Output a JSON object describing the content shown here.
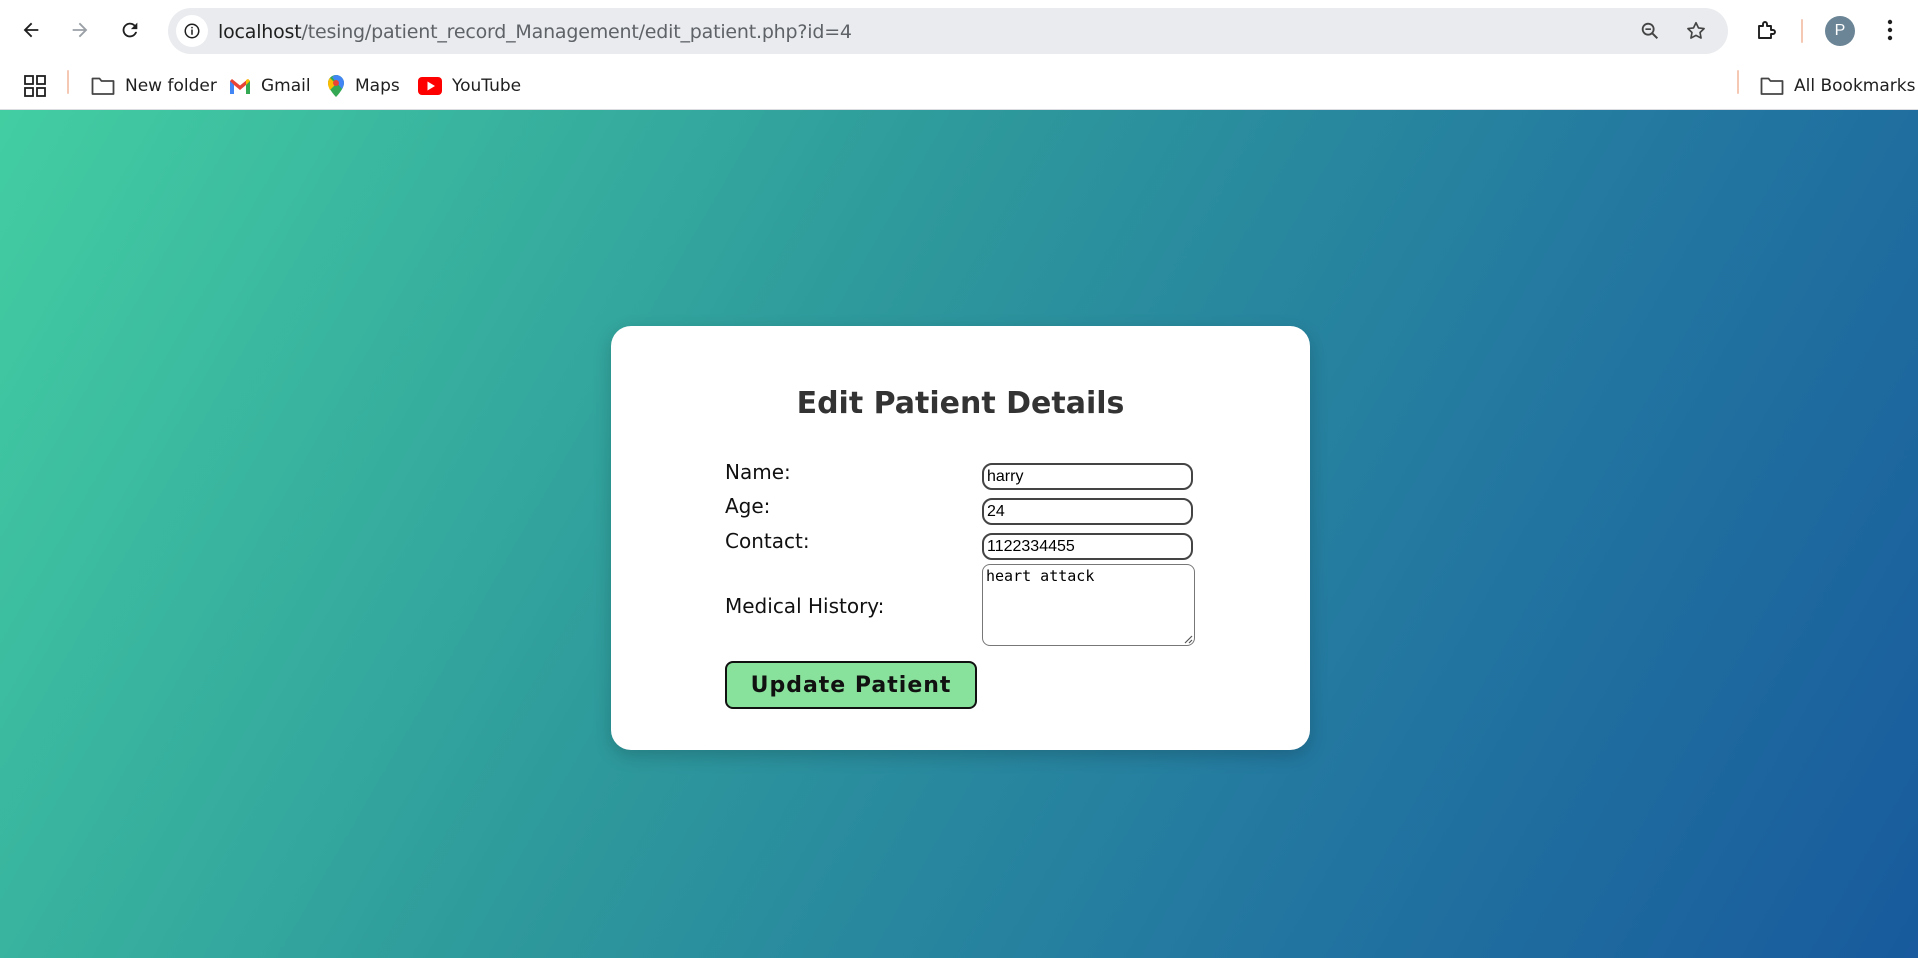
{
  "browser": {
    "url_host": "localhost",
    "url_path": "/tesing/patient_record_Management/edit_patient.php?id=4",
    "profile_initial": "P",
    "bookmarks": [
      {
        "label": "New folder",
        "icon": "folder-icon"
      },
      {
        "label": "Gmail",
        "icon": "gmail-icon"
      },
      {
        "label": "Maps",
        "icon": "maps-icon"
      },
      {
        "label": "YouTube",
        "icon": "youtube-icon"
      }
    ],
    "all_bookmarks_label": "All Bookmarks"
  },
  "form": {
    "title": "Edit Patient Details",
    "name_label": "Name:",
    "name_value": "harry",
    "age_label": "Age:",
    "age_value": "24",
    "contact_label": "Contact:",
    "contact_value": "1122334455",
    "history_label": "Medical History:",
    "history_value": "heart attack",
    "submit_label": "Update Patient"
  },
  "colors": {
    "gradient_start": "#43cea2",
    "gradient_end": "#185a9d",
    "button_bg": "#88e29c"
  }
}
